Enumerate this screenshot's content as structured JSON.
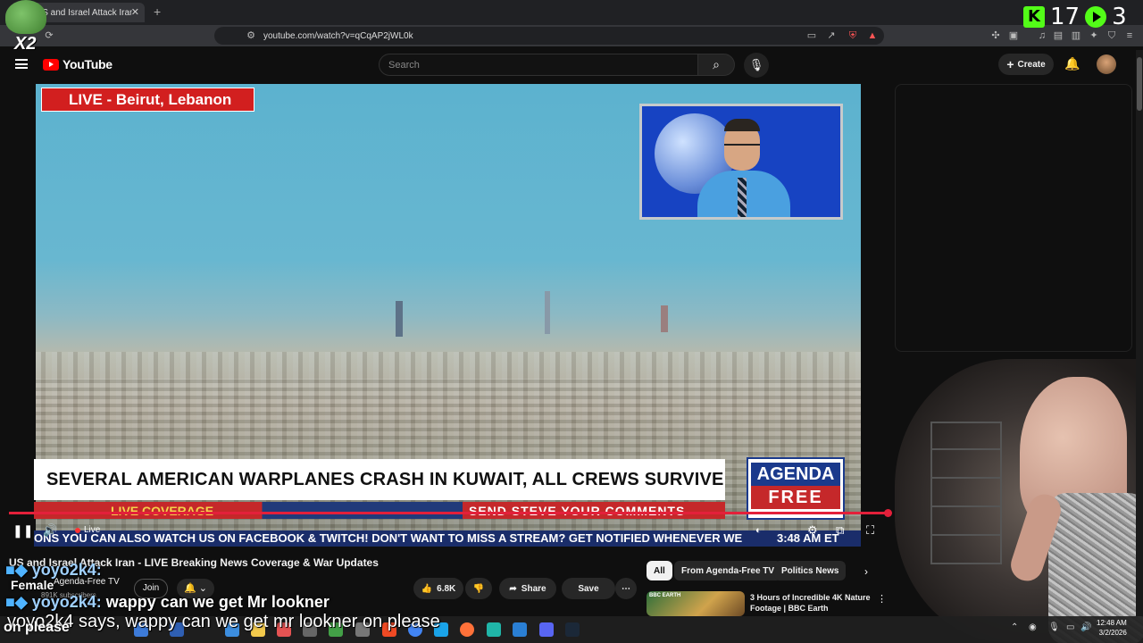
{
  "browser": {
    "tab_title": "US and Israel Attack Iran - LIVE",
    "url": "youtube.com/watch?v=qCqAP2jWL0k"
  },
  "youtube": {
    "logo_text": "YouTube",
    "search_placeholder": "Search",
    "create_label": "Create"
  },
  "video": {
    "live_location": "LIVE - Beirut, Lebanon",
    "headline": "SEVERAL AMERICAN WARPLANES CRASH IN KUWAIT, ALL CREWS SURVIVE",
    "live_coverage": "LIVE COVERAGE",
    "send_comments": "SEND STEVE YOUR COMMENTS",
    "brand_top": "AGENDA",
    "brand_bottom": "FREE",
    "ticker": "ONS   YOU CAN ALSO WATCH US ON FACEBOOK & TWITCH!   DON'T WANT TO MISS A STREAM? GET NOTIFIED WHENEVER WE",
    "clock": "3:48 AM ET",
    "live_label": "Live",
    "progress_fraction": 1.0
  },
  "details": {
    "title": "US and Israel Attack Iran - LIVE Breaking News Coverage & War Updates",
    "channel": "Agenda-Free TV",
    "subscribers": "891K subscribers",
    "join_label": "Join",
    "likes": "6.8K",
    "share_label": "Share",
    "save_label": "Save"
  },
  "recommendations": {
    "chips": [
      "All",
      "From Agenda-Free TV",
      "Politics News"
    ],
    "items": [
      {
        "title": "3 Hours of Incredible 4K Nature Footage | BBC Earth",
        "badge": "BBC EARTH"
      }
    ]
  },
  "overlay": {
    "kick_count": "17",
    "yt_count": "3",
    "multiplier": "X2",
    "chat_user": "yoyo2k4:",
    "chat_message": "wappy can we get Mr lookner",
    "female_label": "Female",
    "tts_text": "yoyo2k4 says, wappy can we get mr lookner on please",
    "tts_overflow": "on please"
  },
  "taskbar": {
    "time": "12:48 AM",
    "date": "3/2/2026"
  },
  "colors": {
    "youtube_red": "#ff0000",
    "progress_red": "#e3203a",
    "kick_green": "#53fc18",
    "badge_red": "#d21f1f",
    "ticker_blue": "#1a2d6a"
  }
}
